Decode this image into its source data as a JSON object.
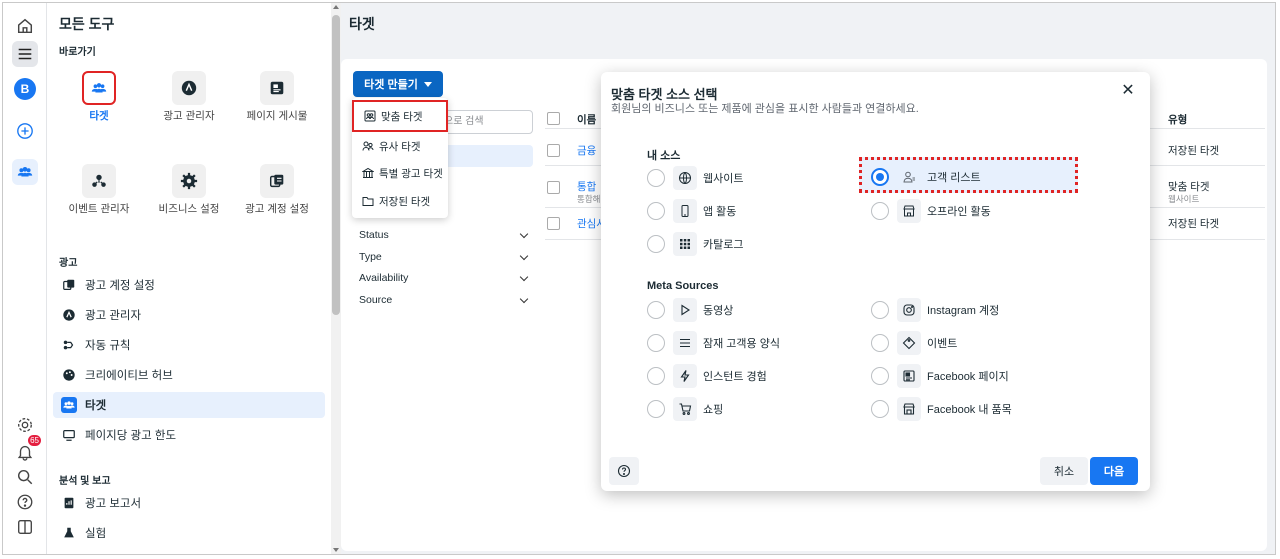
{
  "rail": {
    "account_letter": "B",
    "notification_count": "65"
  },
  "tools_panel": {
    "title": "모든 도구",
    "shortcuts_label": "바로가기",
    "shortcuts": [
      {
        "label": "타겟",
        "icon": "audience-icon"
      },
      {
        "label": "광고 관리자",
        "icon": "ads-manager-icon"
      },
      {
        "label": "페이지 게시물",
        "icon": "page-posts-icon"
      },
      {
        "label": "이벤트 관리자",
        "icon": "events-manager-icon"
      },
      {
        "label": "비즈니스 설정",
        "icon": "gear-icon"
      },
      {
        "label": "광고 계정 설정",
        "icon": "ad-account-settings-icon"
      }
    ],
    "ads_label": "광고",
    "ads_items": [
      {
        "label": "광고 계정 설정"
      },
      {
        "label": "광고 관리자"
      },
      {
        "label": "자동 규칙"
      },
      {
        "label": "크리에이티브 허브"
      },
      {
        "label": "타겟"
      },
      {
        "label": "페이지당 광고 한도"
      }
    ],
    "analytics_label": "분석 및 보고",
    "analytics_items": [
      {
        "label": "광고 보고서"
      },
      {
        "label": "실험"
      }
    ]
  },
  "main": {
    "title": "타겟",
    "create_button": "타겟 만들기",
    "search_placeholder": "으로 검색",
    "filters": [
      "Status",
      "Type",
      "Availability",
      "Source"
    ],
    "table": {
      "col_name": "이름",
      "col_type": "유형",
      "rows": [
        {
          "name": "금융",
          "sub": "",
          "type": "저장된 타겟",
          "type_sub": ""
        },
        {
          "name": "통합",
          "sub": "통합해",
          "type": "맞춤 타겟",
          "type_sub": "웹사이트"
        },
        {
          "name": "관심사",
          "sub": "",
          "type": "저장된 타겟",
          "type_sub": ""
        }
      ]
    }
  },
  "dropdown": {
    "items": [
      {
        "label": "맞춤 타겟"
      },
      {
        "label": "유사 타겟"
      },
      {
        "label": "특별 광고 타겟"
      },
      {
        "label": "저장된 타겟"
      }
    ]
  },
  "modal": {
    "title": "맞춤 타겟 소스 선택",
    "subtitle": "회원님의 비즈니스 또는 제품에 관심을 표시한 사람들과 연결하세요.",
    "own_sources_label": "내 소스",
    "own_sources": [
      {
        "label": "웹사이트",
        "icon": "globe-icon"
      },
      {
        "label": "고객 리스트",
        "icon": "customer-list-icon",
        "selected": true
      },
      {
        "label": "앱 활동",
        "icon": "mobile-app-icon"
      },
      {
        "label": "오프라인 활동",
        "icon": "store-icon"
      },
      {
        "label": "카탈로그",
        "icon": "catalog-icon"
      }
    ],
    "meta_sources_label": "Meta Sources",
    "meta_sources": [
      {
        "label": "동영상",
        "icon": "play-icon"
      },
      {
        "label": "Instagram 계정",
        "icon": "instagram-icon"
      },
      {
        "label": "잠재 고객용 양식",
        "icon": "form-icon"
      },
      {
        "label": "이벤트",
        "icon": "ticket-icon"
      },
      {
        "label": "인스턴트 경험",
        "icon": "lightning-icon"
      },
      {
        "label": "Facebook 페이지",
        "icon": "facebook-page-icon"
      },
      {
        "label": "쇼핑",
        "icon": "cart-icon"
      },
      {
        "label": "Facebook 내 품목",
        "icon": "marketplace-icon"
      }
    ],
    "cancel_label": "취소",
    "next_label": "다음"
  }
}
